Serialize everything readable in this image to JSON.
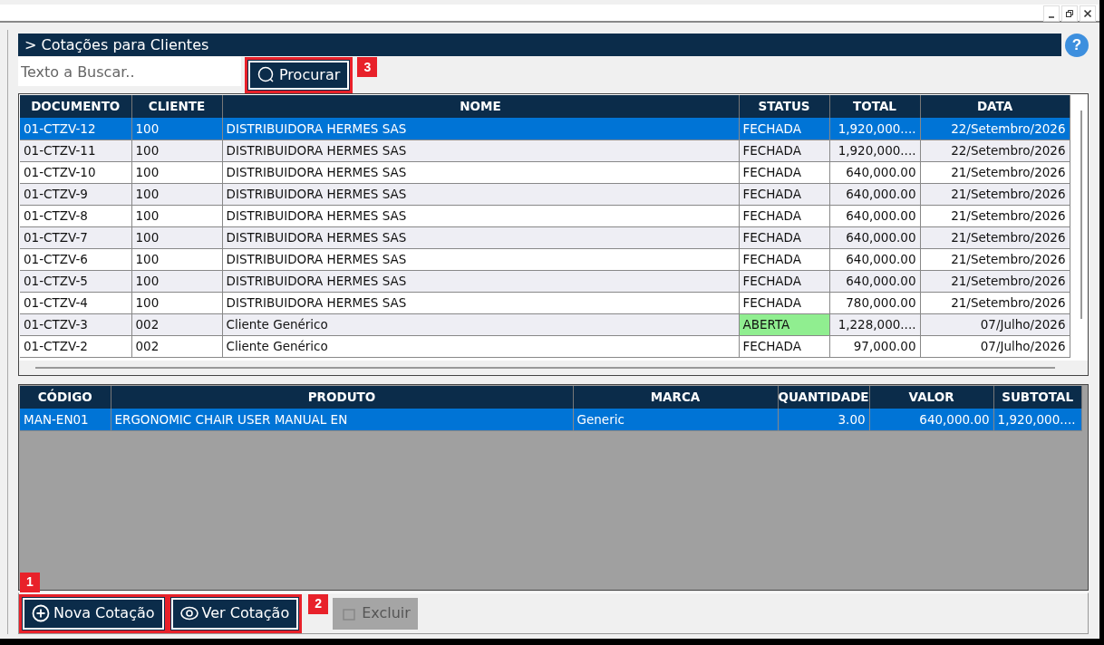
{
  "header": {
    "title": "> Cotações para Clientes",
    "help": "?"
  },
  "search": {
    "placeholder": "Texto a Buscar..",
    "button": "Procurar",
    "callout": "3"
  },
  "quotes": {
    "columns": [
      "DOCUMENTO",
      "CLIENTE",
      "NOME",
      "STATUS",
      "TOTAL",
      "DATA"
    ],
    "rows": [
      {
        "cells": [
          "01-CTZV-12",
          "100",
          "DISTRIBUIDORA HERMES SAS",
          "FECHADA",
          "1,920,000....",
          "22/Setembro/2026"
        ],
        "selected": true,
        "status_open": false
      },
      {
        "cells": [
          "01-CTZV-11",
          "100",
          "DISTRIBUIDORA HERMES SAS",
          "FECHADA",
          "1,920,000....",
          "22/Setembro/2026"
        ],
        "selected": false,
        "status_open": false
      },
      {
        "cells": [
          "01-CTZV-10",
          "100",
          "DISTRIBUIDORA HERMES SAS",
          "FECHADA",
          "640,000.00",
          "21/Setembro/2026"
        ],
        "selected": false,
        "status_open": false
      },
      {
        "cells": [
          "01-CTZV-9",
          "100",
          "DISTRIBUIDORA HERMES SAS",
          "FECHADA",
          "640,000.00",
          "21/Setembro/2026"
        ],
        "selected": false,
        "status_open": false
      },
      {
        "cells": [
          "01-CTZV-8",
          "100",
          "DISTRIBUIDORA HERMES SAS",
          "FECHADA",
          "640,000.00",
          "21/Setembro/2026"
        ],
        "selected": false,
        "status_open": false
      },
      {
        "cells": [
          "01-CTZV-7",
          "100",
          "DISTRIBUIDORA HERMES SAS",
          "FECHADA",
          "640,000.00",
          "21/Setembro/2026"
        ],
        "selected": false,
        "status_open": false
      },
      {
        "cells": [
          "01-CTZV-6",
          "100",
          "DISTRIBUIDORA HERMES SAS",
          "FECHADA",
          "640,000.00",
          "21/Setembro/2026"
        ],
        "selected": false,
        "status_open": false
      },
      {
        "cells": [
          "01-CTZV-5",
          "100",
          "DISTRIBUIDORA HERMES SAS",
          "FECHADA",
          "640,000.00",
          "21/Setembro/2026"
        ],
        "selected": false,
        "status_open": false
      },
      {
        "cells": [
          "01-CTZV-4",
          "100",
          "DISTRIBUIDORA HERMES SAS",
          "FECHADA",
          "780,000.00",
          "21/Setembro/2026"
        ],
        "selected": false,
        "status_open": false
      },
      {
        "cells": [
          "01-CTZV-3",
          "002",
          "Cliente Genérico",
          "ABERTA",
          "1,228,000....",
          "07/Julho/2026"
        ],
        "selected": false,
        "status_open": true
      },
      {
        "cells": [
          "01-CTZV-2",
          "002",
          "Cliente Genérico",
          "FECHADA",
          "97,000.00",
          "07/Julho/2026"
        ],
        "selected": false,
        "status_open": false
      }
    ]
  },
  "items": {
    "columns": [
      "CÓDIGO",
      "PRODUTO",
      "MARCA",
      "QUANTIDADE",
      "VALOR",
      "SUBTOTAL"
    ],
    "rows": [
      {
        "cells": [
          "MAN-EN01",
          "ERGONOMIC CHAIR USER MANUAL EN",
          "Generic",
          "3.00",
          "640,000.00",
          "1,920,000...."
        ],
        "selected": true
      }
    ]
  },
  "actions": [
    {
      "label": "Nova Cotação",
      "kind": "new",
      "disabled": false,
      "callout": "1"
    },
    {
      "label": "Ver Cotação",
      "kind": "view",
      "disabled": false,
      "callout": "2"
    },
    {
      "label": "Excluir",
      "kind": "delete",
      "disabled": true
    }
  ]
}
